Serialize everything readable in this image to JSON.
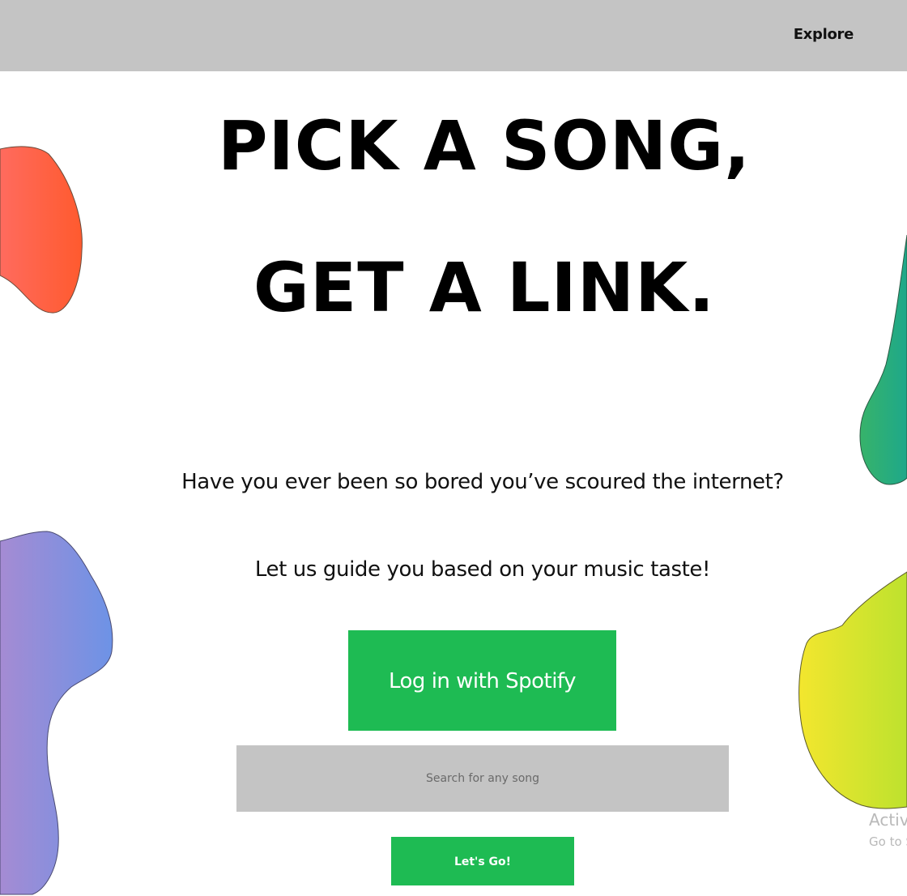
{
  "nav": {
    "explore_label": "Explore"
  },
  "hero": {
    "line1": "PICK A SONG,",
    "line2": "GET A LINK."
  },
  "intro": {
    "line1": "Have you ever been so bored you’ve scoured the internet?",
    "line2": "Let us guide you based on your music taste!"
  },
  "spotify_button": {
    "label": "Log in with Spotify"
  },
  "search": {
    "placeholder": "Search for any song",
    "value": ""
  },
  "go_button": {
    "label": "Let's Go!"
  },
  "watermark": {
    "line1": "Activa",
    "line2": "Go to S"
  },
  "colors": {
    "topbar": "#c4c4c4",
    "accent_green": "#1ebb53",
    "search_bg": "#c4c4c4",
    "blob_orange_start": "#ff6b5e",
    "blob_orange_end": "#ff5a2e",
    "blob_purple_start": "#a58bd3",
    "blob_purple_end": "#6d93e6",
    "blob_green_start": "#37b36a",
    "blob_green_end": "#1ea88a",
    "blob_yellow_start": "#f3e62e",
    "blob_yellow_end": "#bde22e"
  }
}
